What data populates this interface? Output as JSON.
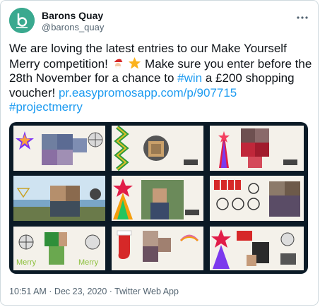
{
  "account": {
    "display_name": "Barons Quay",
    "handle": "@barons_quay"
  },
  "tweet": {
    "text_part1": "We are loving the latest entries to our Make Yourself Merry competition!",
    "text_part2": "Make sure you enter before the 28th November for a chance to",
    "hashtag_win": "#win",
    "text_part3": "a £200 shopping voucher!",
    "link": "pr.easypromosapp.com/p/907715",
    "hashtag_project": "#projectmerry"
  },
  "footer": {
    "timestamp": "10:51 AM · Dec 23, 2020 · Twitter Web App"
  },
  "icons": {
    "avatar": "barons-quay-logo",
    "more": "more-icon",
    "emoji1": "santa-emoji",
    "emoji2": "star-emoji"
  },
  "colors": {
    "accent_link": "#1d9bf0",
    "avatar_bg": "#3aa98f",
    "mosaic_bg": "#0b1a26"
  }
}
